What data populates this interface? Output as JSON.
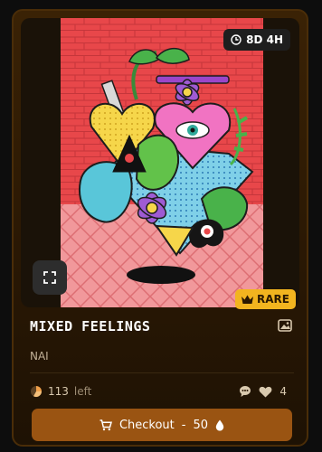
{
  "timer": {
    "text": "8D 4H",
    "icon": "clock-icon"
  },
  "badge": {
    "label": "RARE",
    "icon": "crown-icon"
  },
  "title": "MIXED FEELINGS",
  "artist": "NAI",
  "stock": {
    "count": "113",
    "label": "left",
    "icon": "pie-icon"
  },
  "likes": "4",
  "checkout": {
    "label": "Checkout",
    "sep": "-",
    "price": "50",
    "icon": "cart-icon",
    "currency_icon": "drop-icon"
  },
  "colors": {
    "accent": "#f2b41f",
    "button": "#9a5412",
    "card": "#2a1804"
  }
}
